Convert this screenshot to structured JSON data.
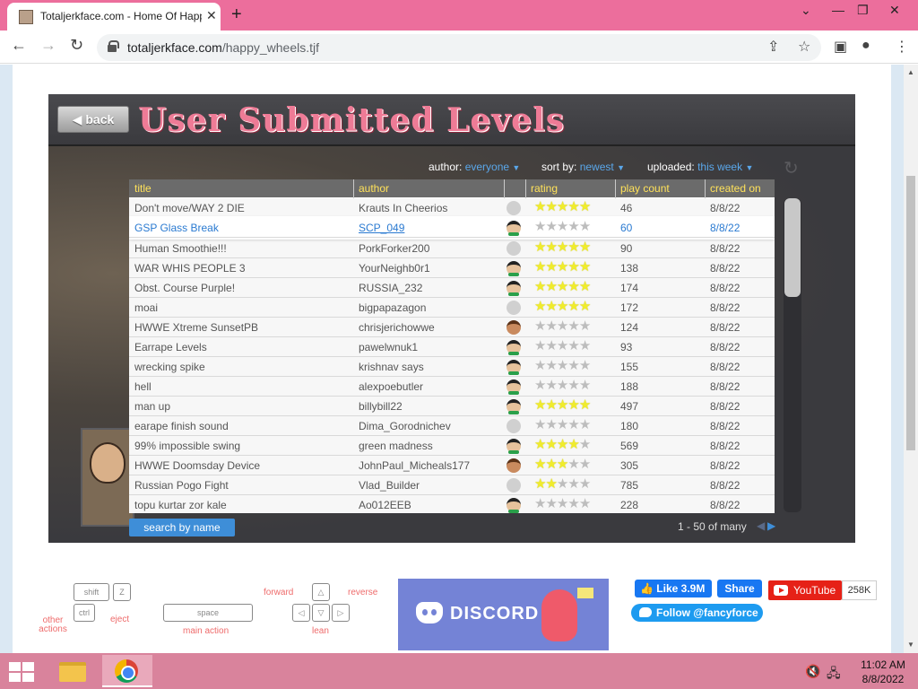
{
  "browser": {
    "tab_title": "Totaljerkface.com - Home Of Happy Wheels",
    "url_host": "totaljerkface.com",
    "url_path": "/happy_wheels.tjf"
  },
  "game": {
    "back_label": "back",
    "title": "User Submitted Levels",
    "filters": {
      "author_label": "author:",
      "author_value": "everyone",
      "sort_label": "sort by:",
      "sort_value": "newest",
      "uploaded_label": "uploaded:",
      "uploaded_value": "this week"
    },
    "columns": [
      "title",
      "author",
      "rating",
      "play count",
      "created on"
    ],
    "rows": [
      {
        "title": "Don't move/WAY 2 DIE",
        "author": "Krauts In Cheerios",
        "avatar": "blank",
        "rating": 5,
        "plays": "46",
        "created": "8/8/22"
      },
      {
        "title": "GSP Glass Break",
        "author": "SCP_049",
        "avatar": "guy",
        "rating": 0,
        "plays": "60",
        "created": "8/8/22"
      },
      {
        "title": "Human Smoothie!!!",
        "author": "PorkForker200",
        "avatar": "blank",
        "rating": 5,
        "plays": "90",
        "created": "8/8/22"
      },
      {
        "title": "WAR WHIS PEOPLE 3",
        "author": "YourNeighb0r1",
        "avatar": "guy",
        "rating": 5,
        "plays": "138",
        "created": "8/8/22"
      },
      {
        "title": "Obst. Course Purple!",
        "author": "RUSSIA_232",
        "avatar": "guy",
        "rating": 5,
        "plays": "174",
        "created": "8/8/22"
      },
      {
        "title": "moai",
        "author": "bigpapazagon",
        "avatar": "blank",
        "rating": 5,
        "plays": "172",
        "created": "8/8/22"
      },
      {
        "title": "HWWE Xtreme SunsetPB",
        "author": "chrisjerichowwe",
        "avatar": "kid",
        "rating": 0,
        "plays": "124",
        "created": "8/8/22"
      },
      {
        "title": "Earrape Levels",
        "author": "pawelwnuk1",
        "avatar": "guy",
        "rating": 0,
        "plays": "93",
        "created": "8/8/22"
      },
      {
        "title": "wrecking spike",
        "author": "krishnav says",
        "avatar": "guy",
        "rating": 0,
        "plays": "155",
        "created": "8/8/22"
      },
      {
        "title": "hell",
        "author": "alexpoebutler",
        "avatar": "guy",
        "rating": 0,
        "plays": "188",
        "created": "8/8/22"
      },
      {
        "title": "man up",
        "author": "billybill22",
        "avatar": "guy",
        "rating": 5,
        "plays": "497",
        "created": "8/8/22"
      },
      {
        "title": "earape finish sound",
        "author": "Dima_Gorodnichev",
        "avatar": "blank",
        "rating": 0,
        "plays": "180",
        "created": "8/8/22"
      },
      {
        "title": "99% impossible swing",
        "author": "green madness",
        "avatar": "guy",
        "rating": 4,
        "plays": "569",
        "created": "8/8/22"
      },
      {
        "title": "HWWE Doomsday Device",
        "author": "JohnPaul_Micheals177",
        "avatar": "kid",
        "rating": 2.5,
        "plays": "305",
        "created": "8/8/22"
      },
      {
        "title": "Russian Pogo Fight",
        "author": "Vlad_Builder",
        "avatar": "blank",
        "rating": 2,
        "plays": "785",
        "created": "8/8/22"
      },
      {
        "title": "topu kurtar zor kale",
        "author": "Ao012EEB",
        "avatar": "guy",
        "rating": 0,
        "plays": "228",
        "created": "8/8/22"
      }
    ],
    "search_label": "search by name",
    "paging": "1 - 50 of many"
  },
  "controls": {
    "shift": "shift",
    "z": "Z",
    "ctrl": "ctrl",
    "space": "space",
    "other_actions": "other actions",
    "eject": "eject",
    "main_action": "main action",
    "forward": "forward",
    "reverse": "reverse",
    "lean": "lean"
  },
  "social": {
    "discord": "DISCORD",
    "fb_like": "Like 3.9M",
    "fb_share": "Share",
    "youtube": "YouTube",
    "youtube_count": "258K",
    "twitter": "Follow @fancyforce"
  },
  "taskbar": {
    "time": "11:02 AM",
    "date": "8/8/2022"
  },
  "colors": {
    "accent_pink": "#ec6e9c",
    "title_pink": "#ee7b96",
    "link_blue": "#2a7ad1",
    "header_yellow": "#ffe25a",
    "star_yellow": "#f0ec2c"
  }
}
